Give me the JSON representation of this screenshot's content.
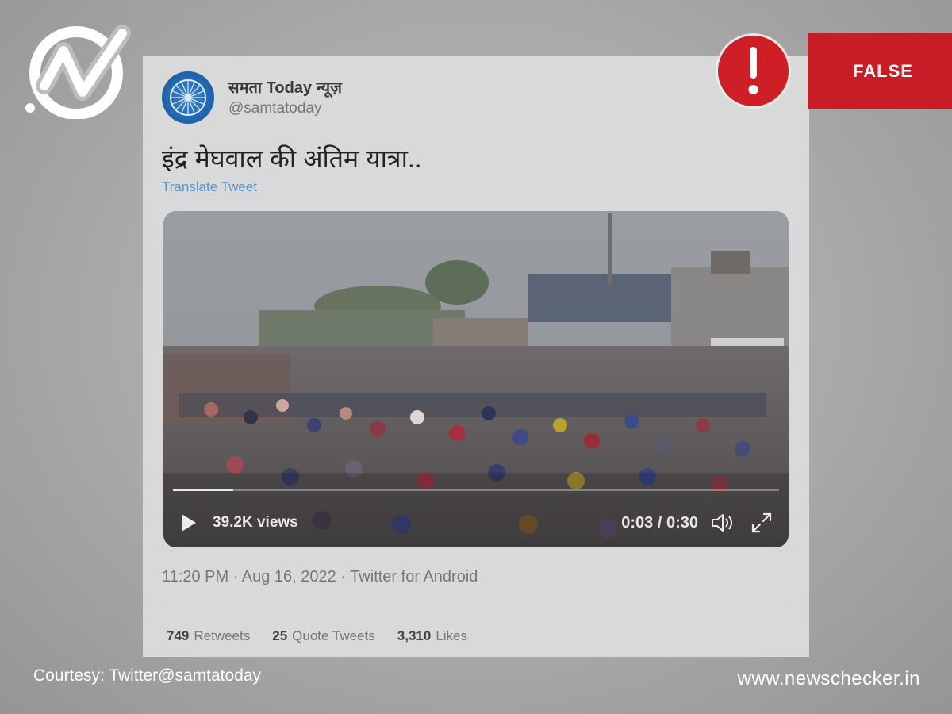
{
  "tweet": {
    "display_name": "समता Today न्यूज़",
    "handle": "@samtatoday",
    "text": "इंद्र मेघवाल की अंतिम यात्रा..",
    "translate_label": "Translate Tweet",
    "video": {
      "views": "39.2K views",
      "time": "0:03 / 0:30",
      "progress": 0.1
    },
    "meta": "11:20 PM · Aug 16, 2022 · Twitter for Android",
    "stats": [
      {
        "count": "749",
        "label": "Retweets"
      },
      {
        "count": "25",
        "label": "Quote Tweets"
      },
      {
        "count": "3,310",
        "label": "Likes"
      }
    ]
  },
  "verdict": {
    "label": "FALSE",
    "color": "#c81d25"
  },
  "footer": {
    "courtesy": "Courtesy: Twitter@samtatoday",
    "site": "www.newschecker.in"
  },
  "icons": [
    "newschecker-logo-icon",
    "alert-icon",
    "play-icon",
    "volume-icon",
    "fullscreen-icon"
  ]
}
